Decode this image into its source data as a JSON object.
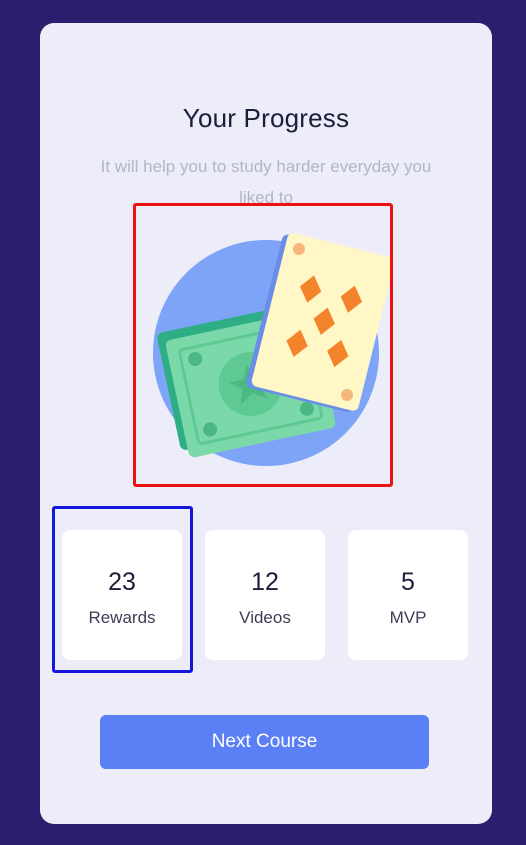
{
  "header": {
    "title": "Your Progress",
    "subtitle": "It will help you to study harder everyday you liked to"
  },
  "illustration": {
    "name": "cash-and-card-illustration",
    "circle_color": "#7ea4f7",
    "card_color": "#fff7c5",
    "pip_color": "#f4842c",
    "banknote_color": "#7bd9a9"
  },
  "stats": [
    {
      "value": "23",
      "label": "Rewards"
    },
    {
      "value": "12",
      "label": "Videos"
    },
    {
      "value": "5",
      "label": "MVP"
    }
  ],
  "actions": {
    "next_label": "Next Course",
    "accent": "#5b7ff5"
  },
  "colors": {
    "background": "#2c1e6e",
    "card": "#ecedf8",
    "highlight_red": "#ee1111",
    "highlight_blue": "#1515dd"
  }
}
